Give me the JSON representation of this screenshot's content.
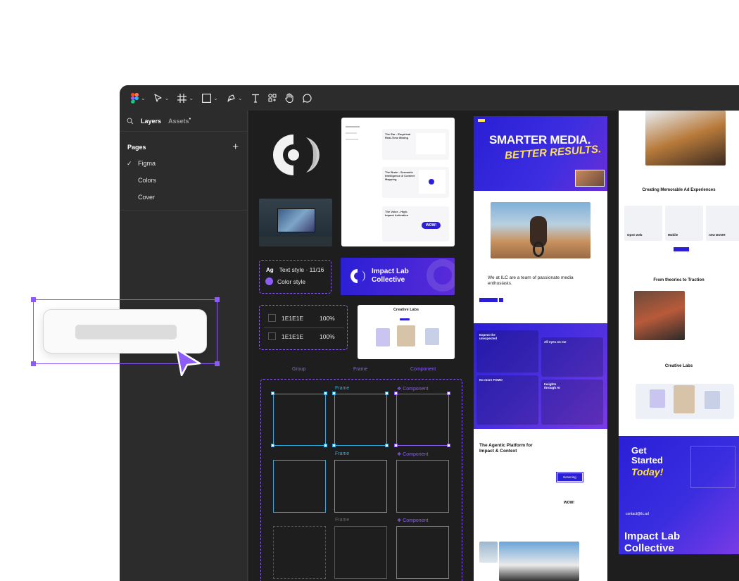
{
  "toolbar": {
    "icons": [
      "figma-logo-icon",
      "move-tool-icon",
      "frame-tool-icon",
      "shape-tool-icon",
      "pen-tool-icon",
      "text-tool-icon",
      "resources-icon",
      "hand-tool-icon",
      "comment-icon"
    ]
  },
  "layers_panel": {
    "tab_layers": "Layers",
    "tab_assets": "Assets",
    "pages_heading": "Pages",
    "pages": [
      "Figma",
      "Colors",
      "Cover"
    ]
  },
  "canvas": {
    "text_style_ag": "Ag",
    "text_style_label": "Text style · 11/16",
    "color_style_label": "Color style",
    "color_rows": [
      {
        "hex": "1E1E1E",
        "opacity": "100%"
      },
      {
        "hex": "1E1E1E",
        "opacity": "100%"
      }
    ],
    "impact_lab_title": "Impact Lab Collective",
    "creative_labs_small": "Creative Labs",
    "legend": {
      "group": "Group",
      "frame": "Frame",
      "component": "Component"
    },
    "row1": {
      "frame": "Frame",
      "component": "Component"
    },
    "row2": {
      "frame": "Frame",
      "component": "Component"
    },
    "row3": {
      "frame": "Frame",
      "component": "Component"
    },
    "listing": {
      "item1_title": "The Ear - Empirical Real-Time Mining",
      "item2_title": "The Brain - Semantic Intelligence & Context Mapping",
      "item3_title": "The Voice - High-Impact Activation",
      "wow": "WOW!"
    }
  },
  "site": {
    "hero_line1": "SMARTER MEDIA.",
    "hero_line2": "BETTER RESULTS.",
    "about_text": "We at ILC are a team of passionate media enthusiasts.",
    "platform_title": "The Agentic Platform for Impact & Context",
    "scanning": "Scanning",
    "wow": "WOW!",
    "expect": "Expect the unexpected",
    "all_eyes": "All eyes on me",
    "no_fomo": "No more FOMO",
    "insights": "Insights through AI"
  },
  "site2": {
    "creating": "Creating Memorable Ad Experiences",
    "open_web": "Open web",
    "mobile": "Mobile",
    "dooh": "new DOOH",
    "theories": "From theories to Traction",
    "creative_labs": "Creative Labs",
    "get_started_1": "Get",
    "get_started_2": "Started",
    "today": "Today!",
    "contact": "contact@ilc.ad",
    "footer_title": "Impact Lab Collective"
  },
  "colors": {
    "accent": "#8b5cf6",
    "frame_blue": "#2ea8e0",
    "brand_blue": "#2a1fd6",
    "canvas_bg": "#1e1e1e",
    "panel_bg": "#2c2c2c"
  }
}
